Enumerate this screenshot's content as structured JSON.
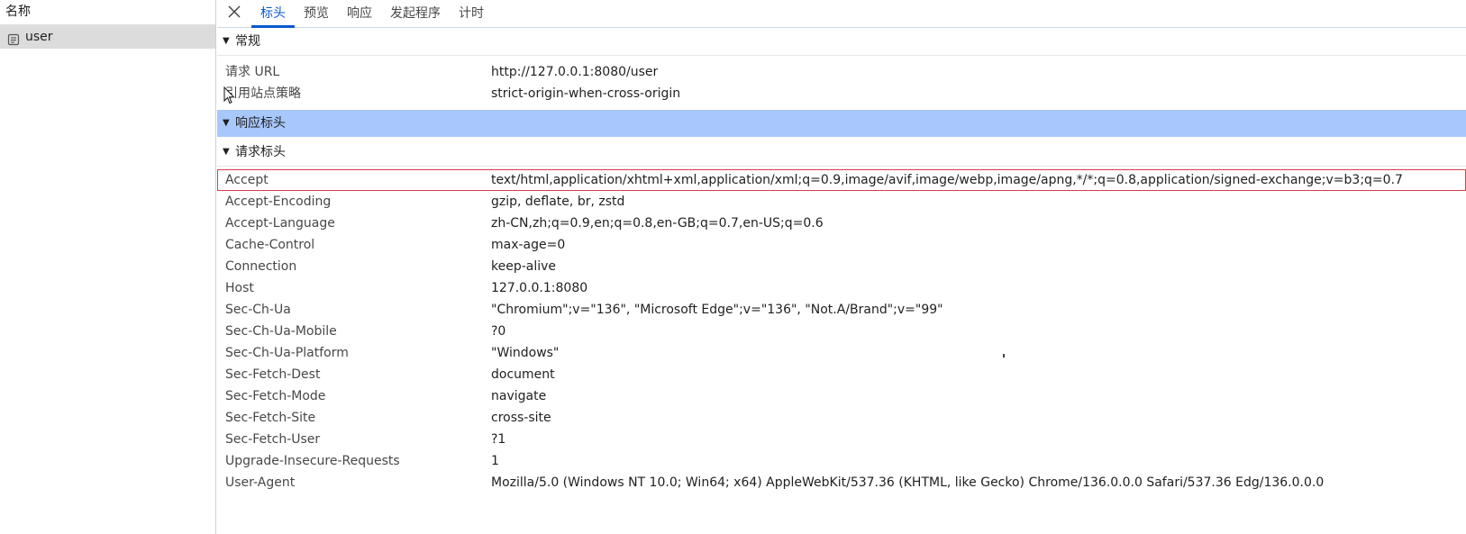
{
  "left_panel": {
    "header": "名称",
    "items": [
      {
        "name": "user",
        "icon": "document-icon",
        "selected": true
      }
    ]
  },
  "tabs": [
    {
      "label": "标头",
      "active": true
    },
    {
      "label": "预览",
      "active": false
    },
    {
      "label": "响应",
      "active": false
    },
    {
      "label": "发起程序",
      "active": false
    },
    {
      "label": "计时",
      "active": false
    }
  ],
  "sections": {
    "general": {
      "title": "常规",
      "rows": [
        {
          "key": "请求 URL",
          "value": "http://127.0.0.1:8080/user"
        },
        {
          "key": "引用站点策略",
          "value": "strict-origin-when-cross-origin"
        }
      ]
    },
    "response_headers": {
      "title": "响应标头"
    },
    "request_headers": {
      "title": "请求标头",
      "rows": [
        {
          "key": "Accept",
          "value": "text/html,application/xhtml+xml,application/xml;q=0.9,image/avif,image/webp,image/apng,*/*;q=0.8,application/signed-exchange;v=b3;q=0.7"
        },
        {
          "key": "Accept-Encoding",
          "value": "gzip, deflate, br, zstd"
        },
        {
          "key": "Accept-Language",
          "value": "zh-CN,zh;q=0.9,en;q=0.8,en-GB;q=0.7,en-US;q=0.6"
        },
        {
          "key": "Cache-Control",
          "value": "max-age=0"
        },
        {
          "key": "Connection",
          "value": "keep-alive"
        },
        {
          "key": "Host",
          "value": "127.0.0.1:8080"
        },
        {
          "key": "Sec-Ch-Ua",
          "value": "\"Chromium\";v=\"136\", \"Microsoft Edge\";v=\"136\", \"Not.A/Brand\";v=\"99\""
        },
        {
          "key": "Sec-Ch-Ua-Mobile",
          "value": "?0"
        },
        {
          "key": "Sec-Ch-Ua-Platform",
          "value": "\"Windows\""
        },
        {
          "key": "Sec-Fetch-Dest",
          "value": "document"
        },
        {
          "key": "Sec-Fetch-Mode",
          "value": "navigate"
        },
        {
          "key": "Sec-Fetch-Site",
          "value": "cross-site"
        },
        {
          "key": "Sec-Fetch-User",
          "value": "?1"
        },
        {
          "key": "Upgrade-Insecure-Requests",
          "value": "1"
        },
        {
          "key": "User-Agent",
          "value": "Mozilla/5.0 (Windows NT 10.0; Win64; x64) AppleWebKit/537.36 (KHTML, like Gecko) Chrome/136.0.0.0 Safari/537.36 Edg/136.0.0.0"
        }
      ]
    }
  },
  "colors": {
    "accent": "#0b57d0",
    "highlight_section": "#a8c7fa",
    "selected_row": "#dcdcdc",
    "box_outline": "#d93a4c"
  }
}
